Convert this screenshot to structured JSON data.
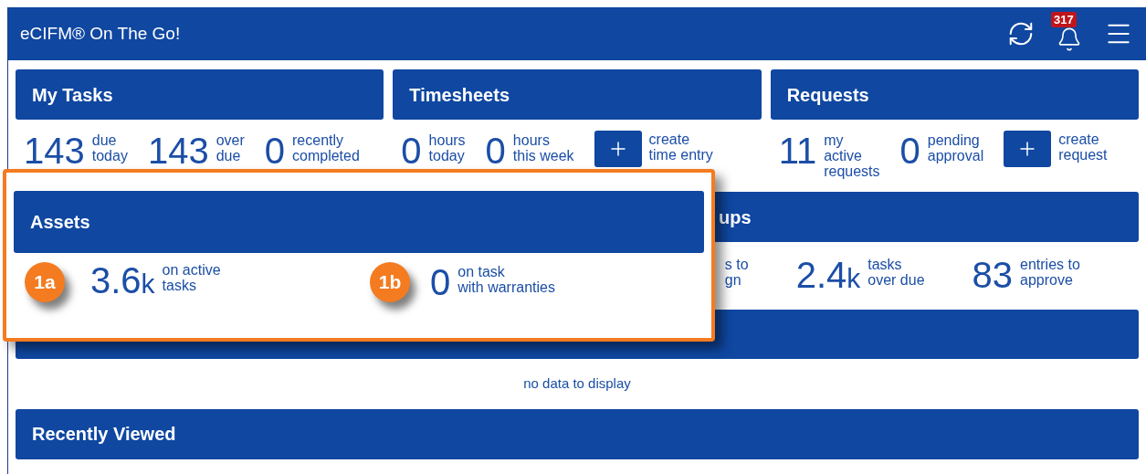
{
  "app_bar": {
    "title": "eCIFM® On The Go!",
    "notification_count": "317"
  },
  "panels": [
    {
      "title": "My Tasks",
      "items": [
        {
          "kind": "stat",
          "value": "143",
          "lines": [
            "due",
            "today"
          ]
        },
        {
          "kind": "stat",
          "value": "143",
          "lines": [
            "over",
            "due"
          ]
        },
        {
          "kind": "stat",
          "value": "0",
          "lines": [
            "recently",
            "completed"
          ]
        }
      ]
    },
    {
      "title": "Timesheets",
      "items": [
        {
          "kind": "stat",
          "value": "0",
          "lines": [
            "hours",
            "today"
          ]
        },
        {
          "kind": "stat",
          "value": "0",
          "lines": [
            "hours",
            "this week"
          ]
        },
        {
          "kind": "action",
          "lines": [
            "create",
            "time entry"
          ]
        }
      ]
    },
    {
      "title": "Requests",
      "items": [
        {
          "kind": "stat",
          "value": "11",
          "lines": [
            "my",
            "active",
            "requests"
          ]
        },
        {
          "kind": "stat",
          "value": "0",
          "lines": [
            "pending",
            "approval"
          ]
        },
        {
          "kind": "action",
          "lines": [
            "create",
            "request"
          ]
        }
      ]
    }
  ],
  "covered_panel": {
    "title": "ups",
    "fragment_lines": [
      "s to",
      "gn"
    ],
    "items": [
      {
        "kind": "stat",
        "value": "2.4",
        "unit": "k",
        "lines": [
          "tasks",
          "over due"
        ]
      },
      {
        "kind": "stat",
        "value": "83",
        "lines": [
          "entries to",
          "approve"
        ]
      }
    ]
  },
  "empty_panel": {
    "message": "no data to display"
  },
  "recent_panel": {
    "title": "Recently Viewed"
  },
  "callout": {
    "title": "Assets",
    "items": [
      {
        "marker": "1a",
        "value": "3.6",
        "unit": "k",
        "lines": [
          "on active",
          "tasks"
        ]
      },
      {
        "marker": "1b",
        "value": "0",
        "lines": [
          "on task",
          "with warranties"
        ]
      }
    ]
  }
}
